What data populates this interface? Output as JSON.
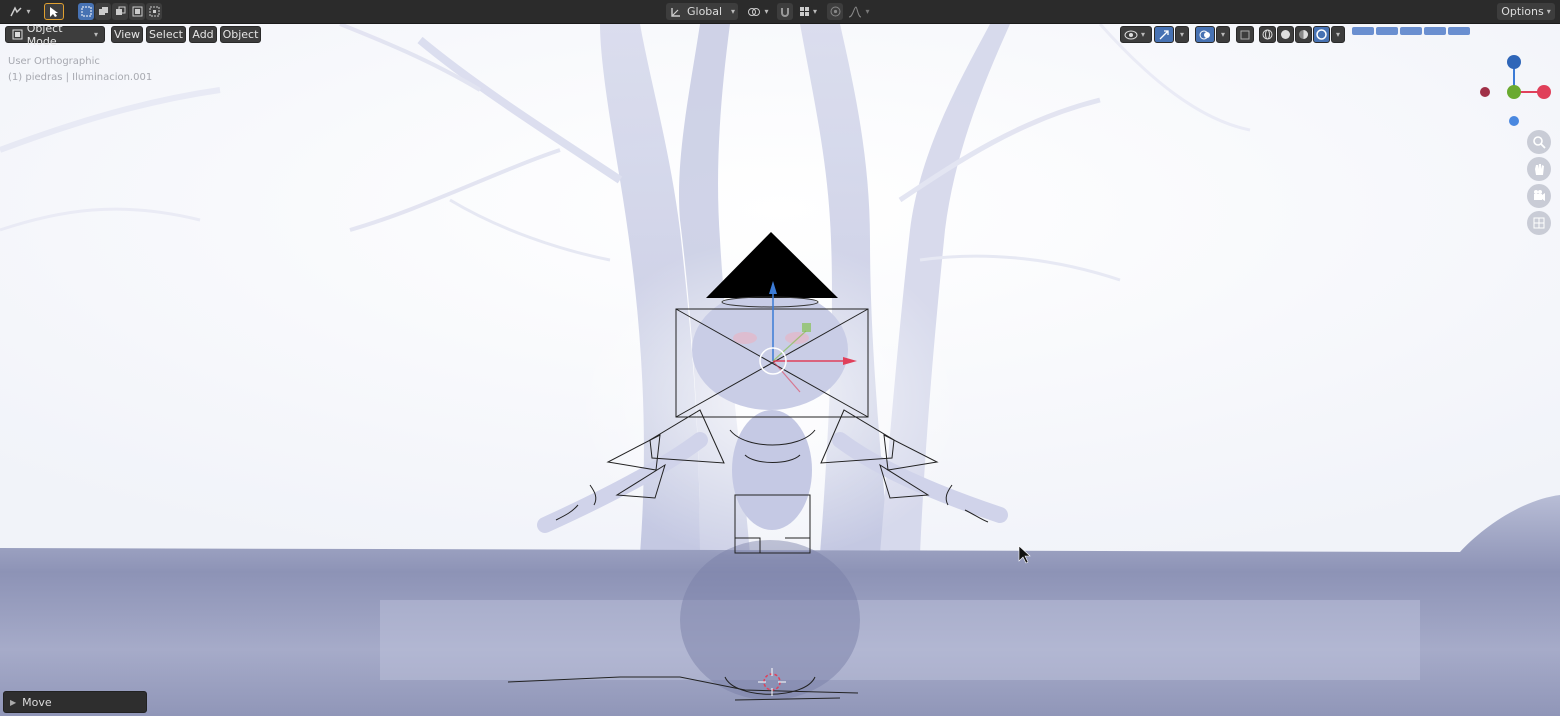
{
  "header": {
    "editor_type_icon": "editor-type-icon",
    "select_tool_icon": "select-box-icon",
    "select_modes": [
      "set-mode-icon",
      "extend-mode-icon",
      "subtract-mode-icon",
      "invert-mode-icon",
      "intersect-mode-icon"
    ],
    "transform_orientation": "Global",
    "pivot_icon": "pivot-point-icon",
    "snap_icon": "snap-icon",
    "proportional_icon": "proportional-edit-icon",
    "options_label": "Options"
  },
  "viewport_header": {
    "mode": "Object Mode",
    "menus": [
      "View",
      "Select",
      "Add",
      "Object"
    ]
  },
  "viewport_info": {
    "view_name": "User Orthographic",
    "object_info": "(1) piedras | Iluminacion.001"
  },
  "navigation": {
    "gizmo_axes": [
      "X",
      "Y",
      "Z"
    ],
    "buttons": [
      "zoom-icon",
      "hand-pan-icon",
      "camera-icon",
      "grid-perspective-icon"
    ]
  },
  "operator_panel": {
    "label": "Move"
  },
  "colors": {
    "header_bg": "#2b2b2b",
    "accent_blue": "#4772b3",
    "axis_x": "#e0405a",
    "axis_y": "#7cbf3c",
    "axis_z": "#3b7bd6"
  }
}
